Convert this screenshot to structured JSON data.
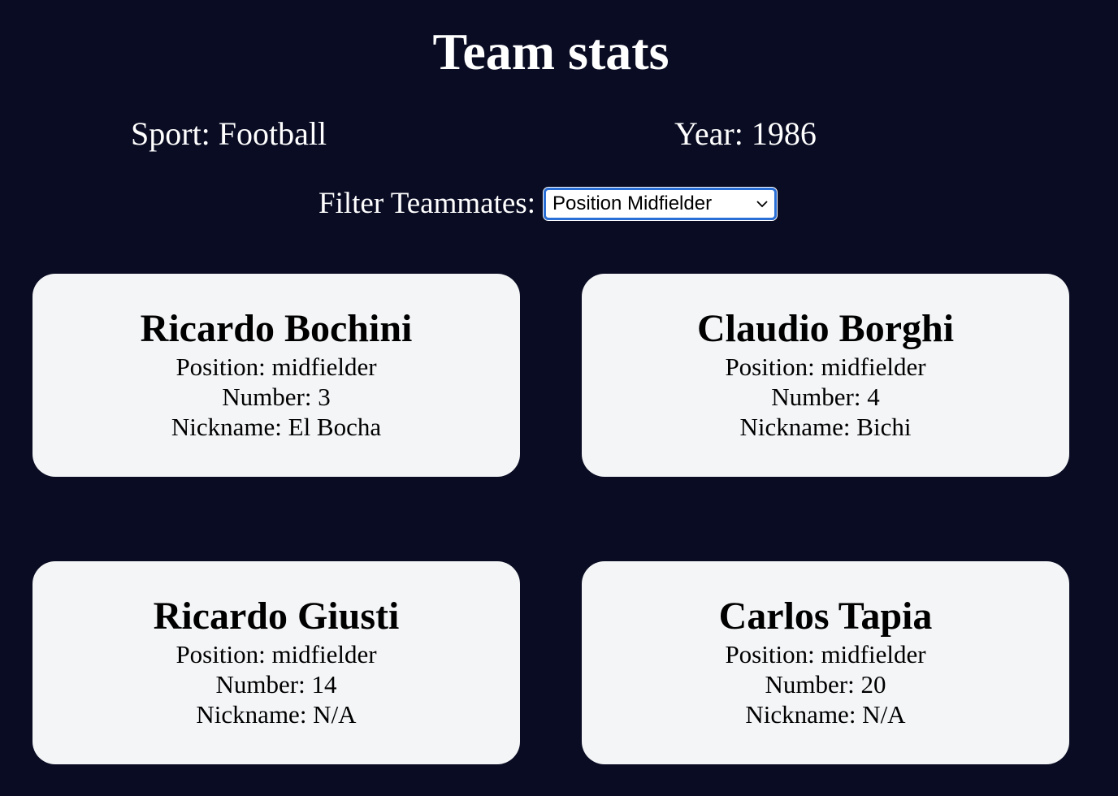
{
  "header": {
    "title": "Team stats"
  },
  "meta": {
    "sport": "Sport: Football",
    "year": "Year: 1986"
  },
  "filter": {
    "label": "Filter Teammates:",
    "selected": "Position Midfielder"
  },
  "players": [
    {
      "name": "Ricardo Bochini",
      "position": "Position: midfielder",
      "number": "Number: 3",
      "nickname": "Nickname: El Bocha"
    },
    {
      "name": "Claudio Borghi",
      "position": "Position: midfielder",
      "number": "Number: 4",
      "nickname": "Nickname: Bichi"
    },
    {
      "name": "Ricardo Giusti",
      "position": "Position: midfielder",
      "number": "Number: 14",
      "nickname": "Nickname: N/A"
    },
    {
      "name": "Carlos Tapia",
      "position": "Position: midfielder",
      "number": "Number: 20",
      "nickname": "Nickname: N/A"
    }
  ],
  "colors": {
    "background": "#0a0c23",
    "card": "#f4f5f7",
    "select_border": "#2a6fd6"
  },
  "icons": {
    "select_arrow": "chevron-down-icon"
  }
}
